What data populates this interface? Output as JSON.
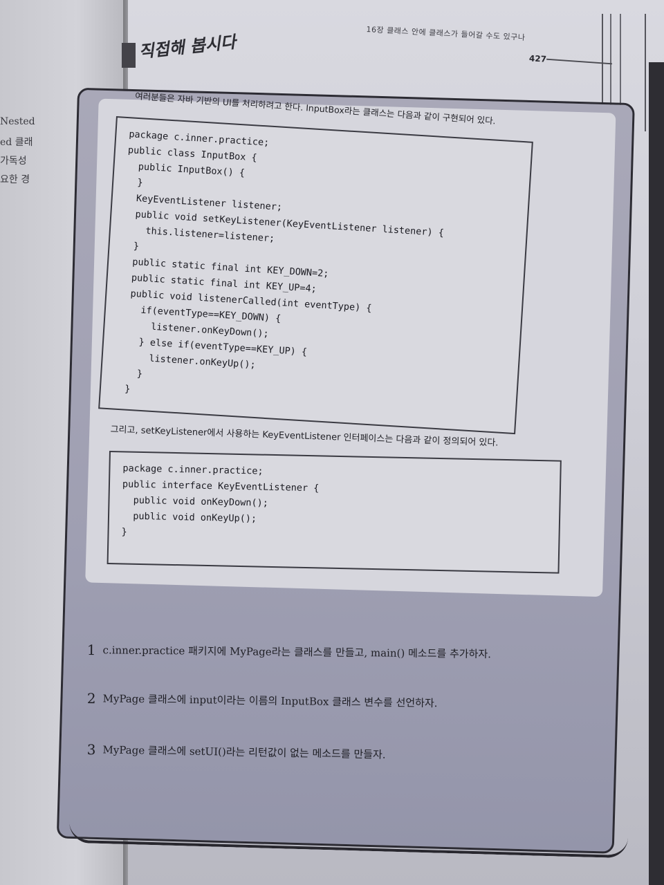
{
  "left_page": {
    "fragments": [
      "Nested",
      "ed 클래",
      "가독성",
      "요한 경"
    ]
  },
  "header": {
    "running_head": "16장 클래스 안에 클래스가 들어갈 수도 있구나",
    "page_number": "427"
  },
  "section_title": "직접해 봅시다",
  "intro_text": "여러분들은 자바 기반의 UI를 처리하려고 한다. InputBox라는 클래스는 다음과 같이 구현되어 있다.",
  "code_block_1": [
    "package c.inner.practice;",
    "",
    "public class InputBox {",
    "  public InputBox() {",
    "  }",
    "  KeyEventListener listener;",
    "  public void setKeyListener(KeyEventListener listener) {",
    "    this.listener=listener;",
    "  }",
    "  public static final int KEY_DOWN=2;",
    "  public static final int KEY_UP=4;",
    "  public void listenerCalled(int eventType) {",
    "    if(eventType==KEY_DOWN) {",
    "      listener.onKeyDown();",
    "    } else if(eventType==KEY_UP) {",
    "      listener.onKeyUp();",
    "    }",
    "  }",
    "}"
  ],
  "mid_text": "그리고, setKeyListener에서 사용하는 KeyEventListener 인터페이스는 다음과 같이 정의되어 있다.",
  "code_block_2": [
    "package c.inner.practice;",
    "",
    "public interface KeyEventListener {",
    "  public void onKeyDown();",
    "  public void onKeyUp();",
    "}"
  ],
  "tasks": [
    {
      "number": "1",
      "text": "c.inner.practice 패키지에 MyPage라는 클래스를 만들고, main() 메소드를 추가하자."
    },
    {
      "number": "2",
      "text": "MyPage 클래스에 input이라는 이름의 InputBox 클래스 변수를 선언하자."
    },
    {
      "number": "3",
      "text": "MyPage 클래스에 setUI()라는 리턴값이 없는 메소드를 만들자."
    }
  ]
}
